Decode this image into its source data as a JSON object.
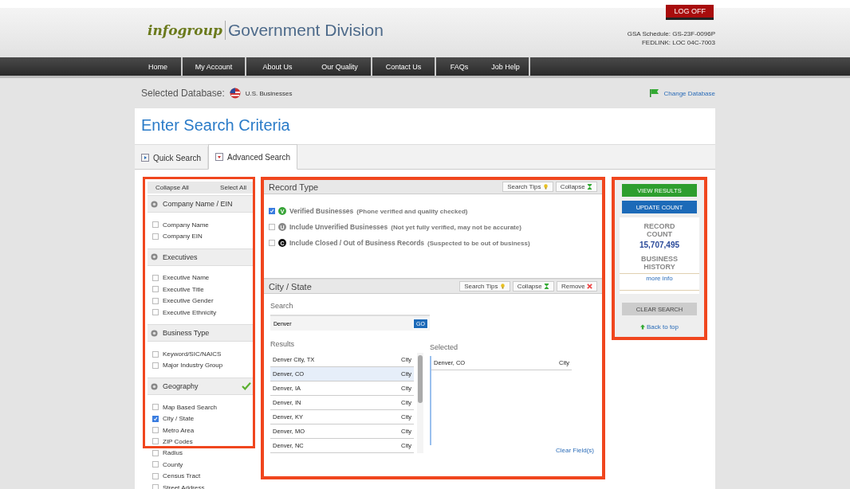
{
  "header": {
    "logo_brand": "infogroup",
    "logo_division": "Government Division",
    "logoff": "LOG OFF",
    "schedule": "GSA Schedule: GS-23F-0096P",
    "fedlink": "FEDLINK: LOC 04C-7003"
  },
  "nav": [
    "Home",
    "My Account",
    "About Us",
    "Our Quality",
    "Contact Us",
    "FAQs",
    "Job Help"
  ],
  "database": {
    "label": "Selected Database:",
    "value": "U.S. Businesses",
    "change": "Change Database"
  },
  "page_title": "Enter Search Criteria",
  "tabs": [
    {
      "label": "Quick Search",
      "selected": false
    },
    {
      "label": "Advanced Search",
      "selected": true
    }
  ],
  "sidebar": {
    "collapse_all": "Collapse All",
    "select_all": "Select All",
    "groups": [
      {
        "title": "Company Name / EIN",
        "complete": false,
        "items": [
          {
            "label": "Company Name",
            "checked": false
          },
          {
            "label": "Company EIN",
            "checked": false
          }
        ]
      },
      {
        "title": "Executives",
        "complete": false,
        "items": [
          {
            "label": "Executive Name",
            "checked": false
          },
          {
            "label": "Executive Title",
            "checked": false
          },
          {
            "label": "Executive Gender",
            "checked": false
          },
          {
            "label": "Executive Ethnicity",
            "checked": false
          }
        ]
      },
      {
        "title": "Business Type",
        "complete": false,
        "items": [
          {
            "label": "Keyword/SIC/NAICS",
            "checked": false
          },
          {
            "label": "Major Industry Group",
            "checked": false
          }
        ]
      },
      {
        "title": "Geography",
        "complete": true,
        "items": [
          {
            "label": "Map Based Search",
            "checked": false
          },
          {
            "label": "City / State",
            "checked": true
          },
          {
            "label": "Metro Area",
            "checked": false
          },
          {
            "label": "ZIP Codes",
            "checked": false
          },
          {
            "label": "Radius",
            "checked": false
          },
          {
            "label": "County",
            "checked": false
          },
          {
            "label": "Census Tract",
            "checked": false
          },
          {
            "label": "Street Address",
            "checked": false
          }
        ]
      }
    ]
  },
  "record_type": {
    "title": "Record Type",
    "tips": "Search Tips",
    "collapse": "Collapse",
    "options": [
      {
        "badge": "V",
        "kind": "verified",
        "label": "Verified Businesses",
        "note": "(Phone verified and quality checked)",
        "checked": true
      },
      {
        "badge": "U",
        "kind": "unverified",
        "label": "Include Unverified Businesses",
        "note": "(Not yet fully verified, may not be accurate)",
        "checked": false
      },
      {
        "badge": "C",
        "kind": "closed",
        "label": "Include Closed / Out of Business Records",
        "note": "(Suspected to be out of business)",
        "checked": false
      }
    ]
  },
  "city_state": {
    "title": "City / State",
    "tips": "Search Tips",
    "collapse": "Collapse",
    "remove": "Remove",
    "search_label": "Search",
    "search_value": "Denver",
    "go": "GO",
    "results_label": "Results",
    "selected_label": "Selected",
    "results": [
      {
        "name": "Denver City, TX",
        "type": "City",
        "selected": false
      },
      {
        "name": "Denver, CO",
        "type": "City",
        "selected": true
      },
      {
        "name": "Denver, IA",
        "type": "City",
        "selected": false
      },
      {
        "name": "Denver, IN",
        "type": "City",
        "selected": false
      },
      {
        "name": "Denver, KY",
        "type": "City",
        "selected": false
      },
      {
        "name": "Denver, MO",
        "type": "City",
        "selected": false
      },
      {
        "name": "Denver, NC",
        "type": "City",
        "selected": false
      }
    ],
    "chosen": [
      {
        "name": "Denver, CO",
        "type": "City"
      }
    ],
    "clear": "Clear Field(s)"
  },
  "actions": {
    "view": "VIEW RESULTS",
    "update": "UPDATE COUNT",
    "count_label": "RECORD COUNT",
    "count": "15,707,495",
    "history": "BUSINESS HISTORY",
    "more": "more info",
    "clear": "CLEAR SEARCH",
    "top": "Back to top"
  }
}
